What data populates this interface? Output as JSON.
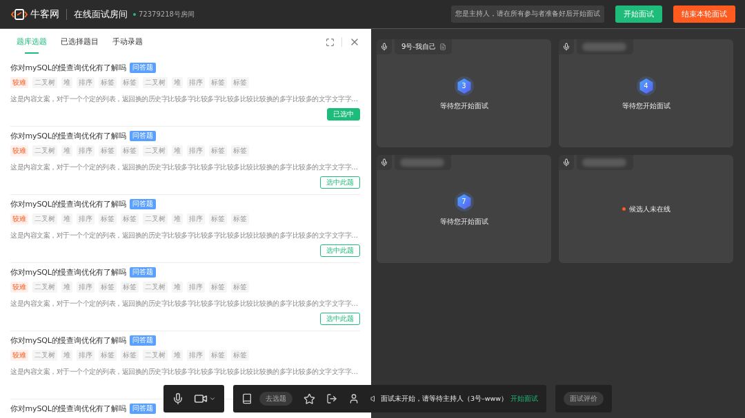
{
  "header": {
    "logo_text": "牛客网",
    "title": "在线面试房间",
    "room": "72379218号房间",
    "notice": "您是主持人，请在所有参与者准备好后开始面试",
    "start_button": "开始面试",
    "end_button": "结束本轮面试"
  },
  "tabs": [
    {
      "label": "题库选题",
      "selected": true
    },
    {
      "label": "已选择题目",
      "selected": false
    },
    {
      "label": "手动录题",
      "selected": false
    }
  ],
  "questions": [
    {
      "title": "你对mySQL的慢查询优化有了解吗",
      "type_tag": "问答题",
      "difficulty": "较难",
      "tags": [
        "二叉树",
        "堆",
        "排序",
        "标签",
        "标签",
        "二叉树",
        "堆",
        "排序",
        "标签",
        "标签"
      ],
      "excerpt": "这是内容文案，对于一个个定的列表，返回换的历史字比较多字比较多字比较多比较比较换的多字比较多的文字文字字…",
      "button": {
        "label": "已选中",
        "selected": true
      }
    },
    {
      "title": "你对mySQL的慢查询优化有了解吗",
      "type_tag": "问答题",
      "difficulty": "较难",
      "tags": [
        "二叉树",
        "堆",
        "排序",
        "标签",
        "标签",
        "二叉树",
        "堆",
        "排序",
        "标签",
        "标签"
      ],
      "excerpt": "这是内容文案，对于一个个定的列表，返回换的历史字比较多字比较多字比较多比较比较换的多字比较多的文字文字字…",
      "button": {
        "label": "选中此题",
        "selected": false
      }
    },
    {
      "title": "你对mySQL的慢查询优化有了解吗",
      "type_tag": "问答题",
      "difficulty": "较难",
      "tags": [
        "二叉树",
        "堆",
        "排序",
        "标签",
        "标签",
        "二叉树",
        "堆",
        "排序",
        "标签",
        "标签"
      ],
      "excerpt": "这是内容文案，对于一个个定的列表，返回换的历史字比较多字比较多字比较多比较比较换的多字比较多的文字文字字…",
      "button": {
        "label": "选中此题",
        "selected": false
      }
    },
    {
      "title": "你对mySQL的慢查询优化有了解吗",
      "type_tag": "问答题",
      "difficulty": "较难",
      "tags": [
        "二叉树",
        "堆",
        "排序",
        "标签",
        "标签",
        "二叉树",
        "堆",
        "排序",
        "标签",
        "标签"
      ],
      "excerpt": "这是内容文案，对于一个个定的列表，返回换的历史字比较多字比较多字比较多比较比较换的多字比较多的文字文字字…",
      "button": {
        "label": "选中此题",
        "selected": false
      }
    },
    {
      "title": "你对mySQL的慢查询优化有了解吗",
      "type_tag": "问答题",
      "difficulty": "较难",
      "tags": [
        "二叉树",
        "堆",
        "排序",
        "标签",
        "标签",
        "二叉树",
        "堆",
        "排序",
        "标签",
        "标签"
      ],
      "excerpt": "这是内容文案，对于一个个定的列表，返回换的历史字比较多字比较多字比较多比较比较换的多字比较多的文字文字字…"
    },
    {
      "title": "你对mySQL的慢查询优化有了解吗",
      "type_tag": "问答题"
    }
  ],
  "tiles": [
    {
      "kind": "waiting",
      "name": "9号-我自己",
      "number": "3",
      "status": "等待您开始面试"
    },
    {
      "kind": "waiting",
      "number": "4",
      "status": "等待您开始面试"
    },
    {
      "kind": "waiting",
      "number": "7",
      "status": "等待您开始面试"
    },
    {
      "kind": "offline",
      "status": "候选人未在线",
      "color": "#ff5a1f"
    }
  ],
  "toolbar": {
    "pick_button": "去选题",
    "status_text": "面试未开始，请等待主持人（3号–www）",
    "start_link": "开始面试",
    "review_button": "面试评价"
  }
}
